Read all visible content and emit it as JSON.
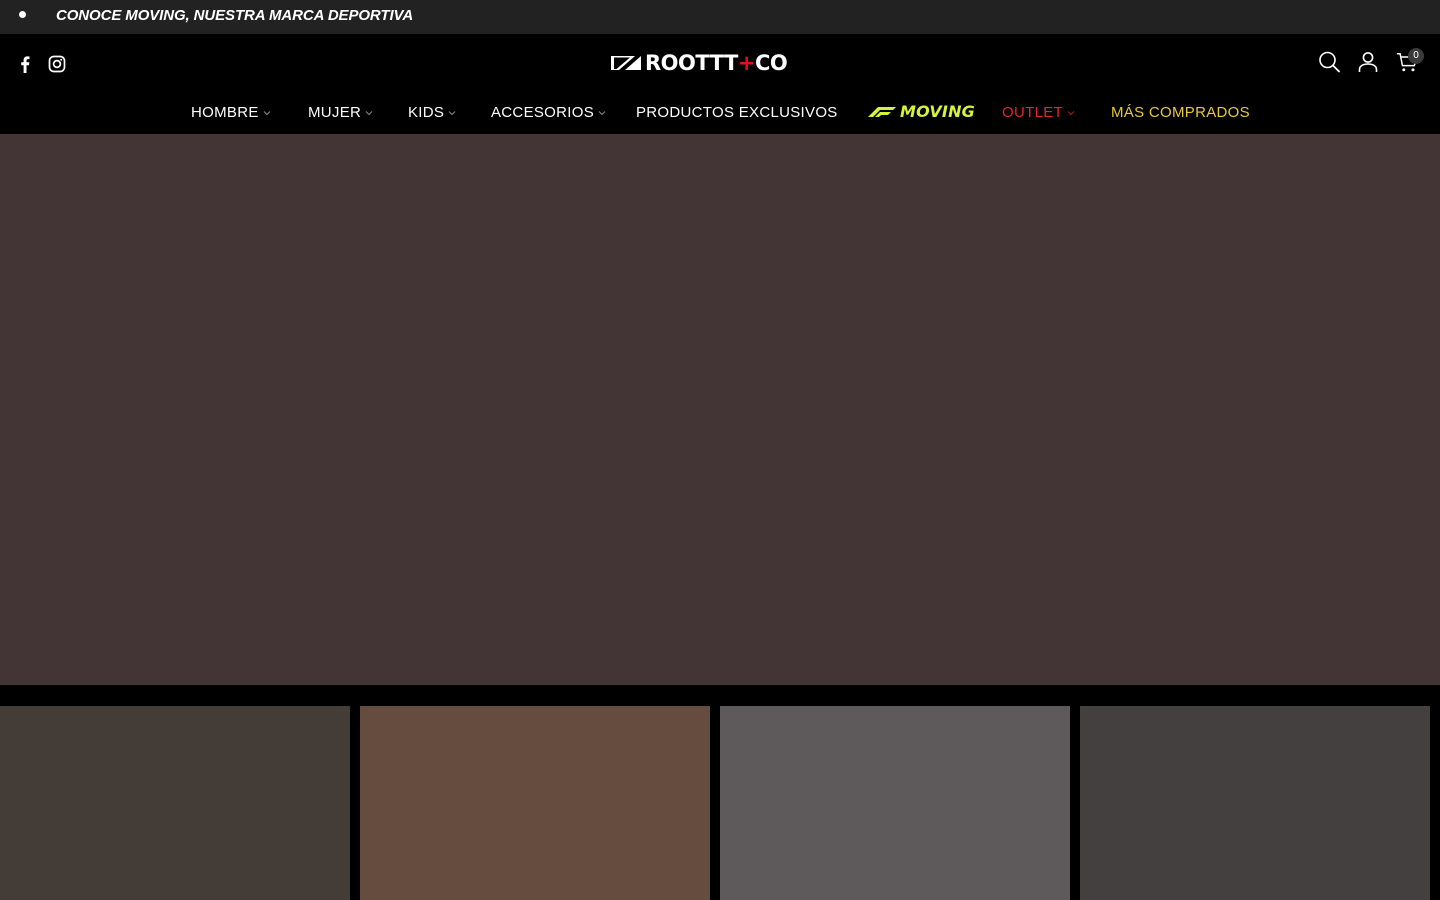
{
  "announcement": {
    "text": "CONOCE MOVING, NUESTRA MARCA DEPORTIVA"
  },
  "header": {
    "social": [
      {
        "icon": "facebook-icon"
      },
      {
        "icon": "instagram-icon"
      }
    ],
    "logo": {
      "text_main": "ROOT",
      "text_cross": "+",
      "text_end": "CO",
      "icon": "roott-logo-mark"
    },
    "tools": {
      "search_icon": "search-icon",
      "account_icon": "account-icon",
      "cart_icon": "cart-icon",
      "cart_count": "0"
    }
  },
  "nav": {
    "items": [
      {
        "label": "HOMBRE",
        "has_dropdown": true
      },
      {
        "label": "MUJER",
        "has_dropdown": true
      },
      {
        "label": "KIDS",
        "has_dropdown": true
      },
      {
        "label": "ACCESORIOS",
        "has_dropdown": true
      },
      {
        "label": "PRODUCTOS EXCLUSIVOS",
        "has_dropdown": false
      },
      {
        "label": "MOVING",
        "has_dropdown": false,
        "color": "#d7f23a"
      },
      {
        "label": "OUTLET",
        "has_dropdown": true,
        "color": "#e2262a"
      },
      {
        "label": "MÁS COMPRADOS",
        "has_dropdown": false,
        "color": "#e8c93a"
      }
    ]
  },
  "colors": {
    "announcement_bg": "#222222",
    "header_bg": "#000000",
    "hero_bg": "#433435",
    "card_1": "#433c37",
    "card_2": "#664b3f",
    "card_3": "#5e5a5b",
    "card_4": "#454040"
  }
}
